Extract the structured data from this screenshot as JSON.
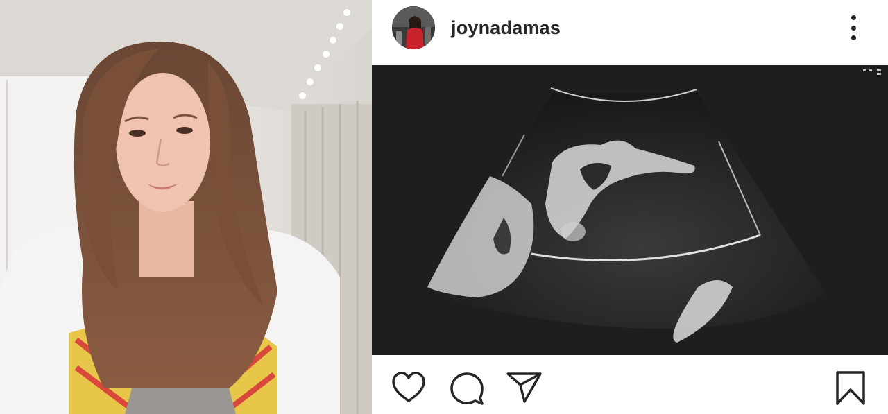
{
  "post": {
    "username": "joynadamas"
  },
  "icons": {
    "more": "more-options-icon",
    "like": "heart-icon",
    "comment": "comment-icon",
    "share": "paper-plane-icon",
    "save": "bookmark-icon"
  },
  "colors": {
    "text": "#262626",
    "media_background": "#1f1f1f"
  }
}
